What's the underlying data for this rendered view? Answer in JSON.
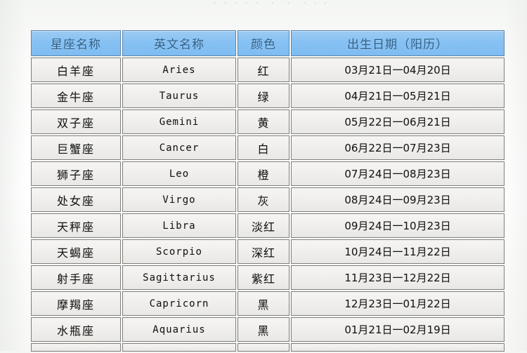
{
  "page": {
    "top_remnant_text": "・・・・・   ・ ・    ・・・",
    "background_color": "#fbfbfa"
  },
  "table": {
    "name": "zodiac-sign-table",
    "header_bg_color": "#87c1f3",
    "header_text_color": "#2f5f86",
    "cell_bg_color": "#efeeec",
    "cell_border_color": "#7e7e7a",
    "columns": [
      {
        "key": "name",
        "label": "星座名称"
      },
      {
        "key": "en",
        "label": "英文名称"
      },
      {
        "key": "color",
        "label": "颜色"
      },
      {
        "key": "date",
        "label": "出生日期（阳历）"
      }
    ],
    "rows": [
      {
        "name": "白羊座",
        "en": "Aries",
        "color": "红",
        "date": "03月21日一04月20日"
      },
      {
        "name": "金牛座",
        "en": "Taurus",
        "color": "绿",
        "date": "04月21日一05月21日"
      },
      {
        "name": "双子座",
        "en": "Gemini",
        "color": "黄",
        "date": "05月22日一06月21日"
      },
      {
        "name": "巨蟹座",
        "en": "Cancer",
        "color": "白",
        "date": "06月22日一07月23日"
      },
      {
        "name": "狮子座",
        "en": "Leo",
        "color": "橙",
        "date": "07月24日一08月23日"
      },
      {
        "name": "处女座",
        "en": "Virgo",
        "color": "灰",
        "date": "08月24日一09月23日"
      },
      {
        "name": "天秤座",
        "en": "Libra",
        "color": "淡红",
        "date": "09月24日一10月23日"
      },
      {
        "name": "天蝎座",
        "en": "Scorpio",
        "color": "深红",
        "date": "10月24日一11月22日"
      },
      {
        "name": "射手座",
        "en": "Sagittarius",
        "color": "紫红",
        "date": "11月23日一12月22日"
      },
      {
        "name": "摩羯座",
        "en": "Capricorn",
        "color": "黑",
        "date": "12月23日一01月22日"
      },
      {
        "name": "水瓶座",
        "en": "Aquarius",
        "color": "黑",
        "date": "01月21日一02月19日"
      }
    ]
  }
}
